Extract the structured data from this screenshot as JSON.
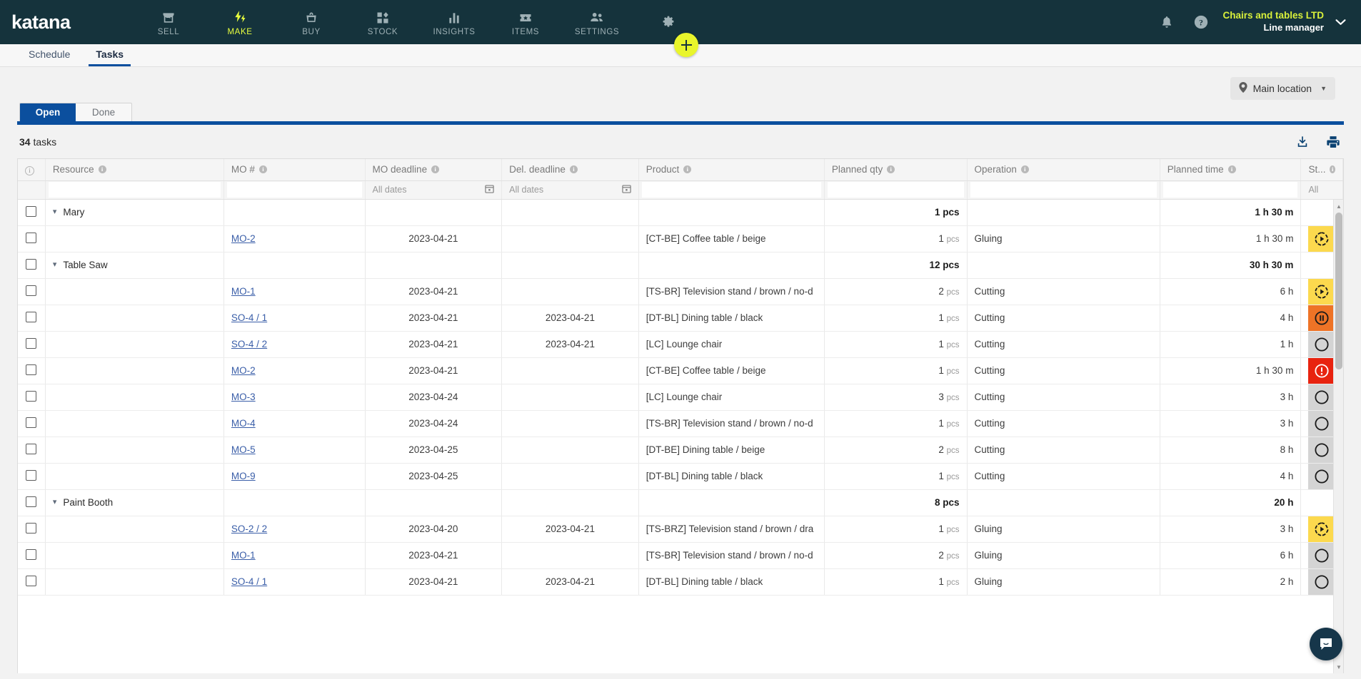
{
  "topnav": {
    "logo": "katana",
    "items": [
      {
        "label": "SELL",
        "icon": "storefront-icon",
        "active": false
      },
      {
        "label": "MAKE",
        "icon": "lightning-icon",
        "active": true
      },
      {
        "label": "BUY",
        "icon": "basket-icon",
        "active": false
      },
      {
        "label": "STOCK",
        "icon": "blocks-icon",
        "active": false
      },
      {
        "label": "INSIGHTS",
        "icon": "bar-chart-icon",
        "active": false
      },
      {
        "label": "ITEMS",
        "icon": "ticket-star-icon",
        "active": false
      },
      {
        "label": "SETTINGS",
        "icon": "gear-icon",
        "active": false
      }
    ],
    "add_button": "add-button",
    "notifications_icon": "bell-icon",
    "help_icon": "question-mark-icon",
    "company_name": "Chairs and tables LTD",
    "company_role": "Line manager",
    "account_chevron": "chevron-down-icon",
    "accent_yellow": "#e9ff3f",
    "bar_color": "#15333c"
  },
  "subtabs": [
    {
      "label": "Schedule",
      "active": false
    },
    {
      "label": "Tasks",
      "active": true
    }
  ],
  "toolbar": {
    "location_label": "Main location",
    "location_icon": "map-pin-icon",
    "segments": [
      {
        "label": "Open",
        "active": true
      },
      {
        "label": "Done",
        "active": false
      }
    ],
    "accent_blue": "#0b4f9e"
  },
  "tasks": {
    "count": "34",
    "count_suffix": "tasks",
    "download_icon": "download-icon",
    "print_icon": "print-icon"
  },
  "table": {
    "columns": [
      {
        "key": "info",
        "label": "",
        "info": false
      },
      {
        "key": "resource",
        "label": "Resource",
        "info": true
      },
      {
        "key": "mo",
        "label": "MO #",
        "info": true
      },
      {
        "key": "mo_deadline",
        "label": "MO deadline",
        "info": true
      },
      {
        "key": "del_deadline",
        "label": "Del. deadline",
        "info": true
      },
      {
        "key": "product",
        "label": "Product",
        "info": true
      },
      {
        "key": "planned_qty",
        "label": "Planned qty",
        "info": true
      },
      {
        "key": "operation",
        "label": "Operation",
        "info": true
      },
      {
        "key": "planned_time",
        "label": "Planned time",
        "info": true
      },
      {
        "key": "status",
        "label": "St...",
        "info": true
      }
    ],
    "filters": {
      "mo_deadline_placeholder": "All dates",
      "del_deadline_placeholder": "All dates",
      "status_value": "All",
      "calendar_icon": "calendar-icon"
    },
    "rows": [
      {
        "type": "group",
        "resource": "Mary",
        "mo": "",
        "mo_deadline": "",
        "del_deadline": "",
        "product": "",
        "qty": "1",
        "qty_unit": "pcs",
        "operation": "",
        "planned_time": "1 h 30 m",
        "status": "none"
      },
      {
        "type": "task",
        "resource": "",
        "mo": "MO-2",
        "mo_deadline": "2023-04-21",
        "del_deadline": "",
        "product": "[CT-BE] Coffee table / beige",
        "qty": "1",
        "qty_unit": "pcs",
        "operation": "Gluing",
        "planned_time": "1 h 30 m",
        "status": "in-progress"
      },
      {
        "type": "group",
        "resource": "Table Saw",
        "mo": "",
        "mo_deadline": "",
        "del_deadline": "",
        "product": "",
        "qty": "12",
        "qty_unit": "pcs",
        "operation": "",
        "planned_time": "30 h 30 m",
        "status": "none"
      },
      {
        "type": "task",
        "resource": "",
        "mo": "MO-1",
        "mo_deadline": "2023-04-21",
        "del_deadline": "",
        "product": "[TS-BR] Television stand / brown / no-d",
        "qty": "2",
        "qty_unit": "pcs",
        "operation": "Cutting",
        "planned_time": "6 h",
        "status": "in-progress"
      },
      {
        "type": "task",
        "resource": "",
        "mo": "SO-4 / 1",
        "mo_deadline": "2023-04-21",
        "del_deadline": "2023-04-21",
        "product": "[DT-BL] Dining table / black",
        "qty": "1",
        "qty_unit": "pcs",
        "operation": "Cutting",
        "planned_time": "4 h",
        "status": "paused"
      },
      {
        "type": "task",
        "resource": "",
        "mo": "SO-4 / 2",
        "mo_deadline": "2023-04-21",
        "del_deadline": "2023-04-21",
        "product": "[LC] Lounge chair",
        "qty": "1",
        "qty_unit": "pcs",
        "operation": "Cutting",
        "planned_time": "1 h",
        "status": "not-started"
      },
      {
        "type": "task",
        "resource": "",
        "mo": "MO-2",
        "mo_deadline": "2023-04-21",
        "del_deadline": "",
        "product": "[CT-BE] Coffee table / beige",
        "qty": "1",
        "qty_unit": "pcs",
        "operation": "Cutting",
        "planned_time": "1 h 30 m",
        "status": "blocked"
      },
      {
        "type": "task",
        "resource": "",
        "mo": "MO-3",
        "mo_deadline": "2023-04-24",
        "del_deadline": "",
        "product": "[LC] Lounge chair",
        "qty": "3",
        "qty_unit": "pcs",
        "operation": "Cutting",
        "planned_time": "3 h",
        "status": "not-started"
      },
      {
        "type": "task",
        "resource": "",
        "mo": "MO-4",
        "mo_deadline": "2023-04-24",
        "del_deadline": "",
        "product": "[TS-BR] Television stand / brown / no-d",
        "qty": "1",
        "qty_unit": "pcs",
        "operation": "Cutting",
        "planned_time": "3 h",
        "status": "not-started"
      },
      {
        "type": "task",
        "resource": "",
        "mo": "MO-5",
        "mo_deadline": "2023-04-25",
        "del_deadline": "",
        "product": "[DT-BE] Dining table / beige",
        "qty": "2",
        "qty_unit": "pcs",
        "operation": "Cutting",
        "planned_time": "8 h",
        "status": "not-started"
      },
      {
        "type": "task",
        "resource": "",
        "mo": "MO-9",
        "mo_deadline": "2023-04-25",
        "del_deadline": "",
        "product": "[DT-BL] Dining table / black",
        "qty": "1",
        "qty_unit": "pcs",
        "operation": "Cutting",
        "planned_time": "4 h",
        "status": "not-started"
      },
      {
        "type": "group",
        "resource": "Paint Booth",
        "mo": "",
        "mo_deadline": "",
        "del_deadline": "",
        "product": "",
        "qty": "8",
        "qty_unit": "pcs",
        "operation": "",
        "planned_time": "20 h",
        "status": "none"
      },
      {
        "type": "task",
        "resource": "",
        "mo": "SO-2 / 2",
        "mo_deadline": "2023-04-20",
        "del_deadline": "2023-04-21",
        "product": "[TS-BRZ] Television stand / brown / dra",
        "qty": "1",
        "qty_unit": "pcs",
        "operation": "Gluing",
        "planned_time": "3 h",
        "status": "in-progress"
      },
      {
        "type": "task",
        "resource": "",
        "mo": "MO-1",
        "mo_deadline": "2023-04-21",
        "del_deadline": "",
        "product": "[TS-BR] Television stand / brown / no-d",
        "qty": "2",
        "qty_unit": "pcs",
        "operation": "Gluing",
        "planned_time": "6 h",
        "status": "not-started"
      },
      {
        "type": "task",
        "resource": "",
        "mo": "SO-4 / 1",
        "mo_deadline": "2023-04-21",
        "del_deadline": "2023-04-21",
        "product": "[DT-BL] Dining table / black",
        "qty": "1",
        "qty_unit": "pcs",
        "operation": "Gluing",
        "planned_time": "2 h",
        "status": "not-started"
      }
    ],
    "status_colors": {
      "in-progress": "#fcd94e",
      "paused": "#ee7326",
      "not-started": "#d4d4d4",
      "blocked": "#e8230f"
    }
  },
  "chat": {
    "icon": "chat-bubble-icon"
  }
}
